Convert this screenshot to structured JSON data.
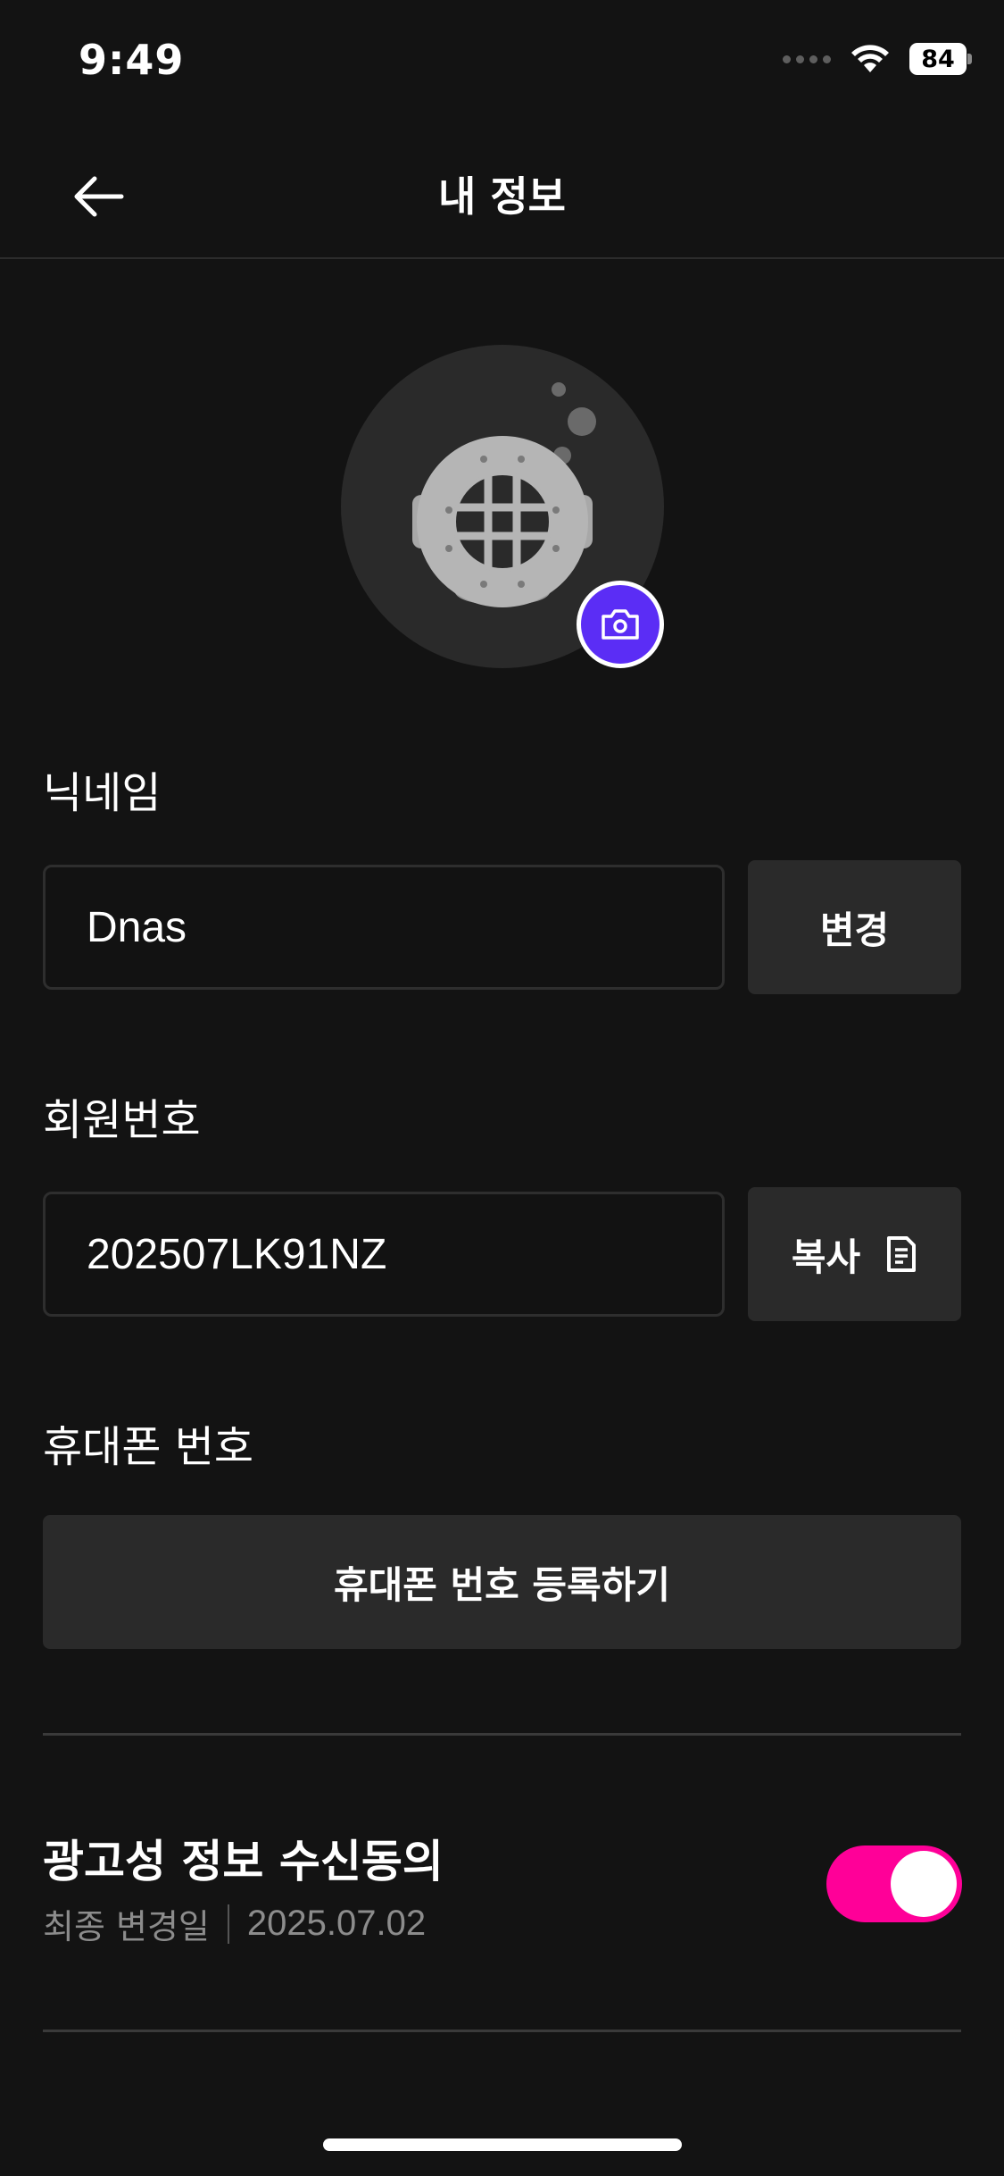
{
  "status_bar": {
    "time": "9:49",
    "battery": "84"
  },
  "header": {
    "title": "내 정보"
  },
  "profile": {
    "avatar_icon": "diving-helmet-icon",
    "camera_icon": "camera-icon",
    "accent_color": "#5b2df5"
  },
  "nickname": {
    "label": "닉네임",
    "value": "Dnas",
    "button_label": "변경"
  },
  "member_number": {
    "label": "회원번호",
    "value": "202507LK91NZ",
    "button_label": "복사",
    "button_icon": "copy-icon"
  },
  "phone": {
    "label": "휴대폰 번호",
    "button_label": "휴대폰 번호 등록하기"
  },
  "marketing_consent": {
    "title": "광고성 정보 수신동의",
    "changed_label": "최종 변경일",
    "changed_date": "2025.07.02",
    "enabled": true,
    "toggle_color": "#ff0098"
  }
}
